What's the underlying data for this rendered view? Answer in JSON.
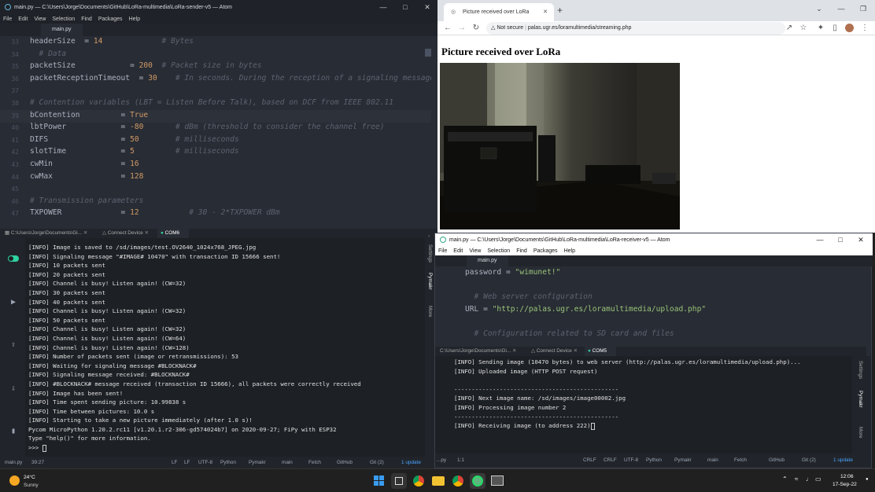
{
  "sender": {
    "title": "main.py — C:\\Users\\Jorge\\Documents\\GitHub\\LoRa-multimedia\\LoRa-sender-v5 — Atom",
    "menu": [
      "File",
      "Edit",
      "View",
      "Selection",
      "Find",
      "Packages",
      "Help"
    ],
    "tab": "main.py",
    "lines": [
      {
        "n": "33",
        "parts": [
          [
            "",
            "headerSize  = "
          ],
          [
            "kw",
            "14"
          ],
          [
            "",
            "             "
          ],
          [
            "cm",
            "# Bytes"
          ]
        ]
      },
      {
        "n": "34",
        "parts": [
          [
            "cm",
            "  # Data"
          ]
        ]
      },
      {
        "n": "35",
        "parts": [
          [
            "",
            "packetSize            = "
          ],
          [
            "kw",
            "200"
          ],
          [
            "",
            "  "
          ],
          [
            "cm",
            "# Packet size in bytes"
          ]
        ]
      },
      {
        "n": "36",
        "parts": [
          [
            "",
            "packetReceptionTimeout  = "
          ],
          [
            "kw",
            "30"
          ],
          [
            "",
            "    "
          ],
          [
            "cm",
            "# In seconds. During the reception of a signaling message"
          ]
        ]
      },
      {
        "n": "37",
        "parts": [
          [
            "",
            ""
          ]
        ]
      },
      {
        "n": "38",
        "parts": [
          [
            "cm",
            "# Contention variables (LBT = Listen Before Talk), based on DCF from IEEE 802.11"
          ]
        ]
      },
      {
        "n": "39",
        "parts": [
          [
            "",
            "bContention         = "
          ],
          [
            "kw",
            "True"
          ]
        ]
      },
      {
        "n": "40",
        "parts": [
          [
            "",
            "lbtPower            = "
          ],
          [
            "kw",
            "-80"
          ],
          [
            "",
            "       "
          ],
          [
            "cm",
            "# dBm (threshold to consider the channel free)"
          ]
        ]
      },
      {
        "n": "41",
        "parts": [
          [
            "",
            "DIFS                = "
          ],
          [
            "kw",
            "50"
          ],
          [
            "",
            "        "
          ],
          [
            "cm",
            "# milliseconds"
          ]
        ]
      },
      {
        "n": "42",
        "parts": [
          [
            "",
            "slotTime            = "
          ],
          [
            "kw",
            "5"
          ],
          [
            "",
            "         "
          ],
          [
            "cm",
            "# milliseconds"
          ]
        ]
      },
      {
        "n": "43",
        "parts": [
          [
            "",
            "cwMin               = "
          ],
          [
            "kw",
            "16"
          ]
        ]
      },
      {
        "n": "44",
        "parts": [
          [
            "",
            "cwMax               = "
          ],
          [
            "kw",
            "128"
          ]
        ]
      },
      {
        "n": "45",
        "parts": [
          [
            "",
            ""
          ]
        ]
      },
      {
        "n": "46",
        "parts": [
          [
            "cm",
            "# Transmission parameters"
          ]
        ]
      },
      {
        "n": "47",
        "parts": [
          [
            "",
            "TXPOWER             = "
          ],
          [
            "kw",
            "12"
          ],
          [
            "",
            "           "
          ],
          [
            "cm",
            "# 30 - 2*TXPOWER dBm"
          ]
        ]
      }
    ],
    "panel_tabs": [
      "C:\\Users\\Jorge\\Documents\\Gi...",
      "Connect Device",
      "COM6"
    ],
    "console": [
      "[INFO] Image is saved to /sd/images/test.OV2640_1024x768_JPEG.jpg",
      "[INFO] Signaling message \"#IMAGE# 10470\" with transaction ID 15666 sent!",
      "[INFO] 10 packets sent",
      "[INFO] 20 packets sent",
      "[INFO] Channel is busy! Listen again! (CW=32)",
      "[INFO] 30 packets sent",
      "[INFO] 40 packets sent",
      "[INFO] Channel is busy! Listen again! (CW=32)",
      "[INFO] 50 packets sent",
      "[INFO] Channel is busy! Listen again! (CW=32)",
      "[INFO] Channel is busy! Listen again! (CW=64)",
      "[INFO] Channel is busy! Listen again! (CW=128)",
      "[INFO] Number of packets sent (image or retransmissions): 53",
      "[INFO] Waiting for signaling message #BLOCKNACK#",
      "[INFO] Signaling message received: #BLOCKNACK#",
      "[INFO] #BLOCKNACK# message received (transaction ID 15666), all packets were correctly received",
      "[INFO] Image has been sent!",
      "[INFO] Time spent sending picture: 10.99838 s",
      "[INFO] Time between pictures: 10.0 s",
      "[INFO] Starting to take a new picture immediately (after 1.0 s)!",
      "Pycom MicroPython 1.20.2.rc11 [v1.20.1.r2-306-gd574024b7] on 2020-09-27; FiPy with ESP32",
      "Type \"help()\" for more information.",
      ">>> "
    ],
    "side_labels": [
      "Settings",
      "Pymakr",
      "More"
    ],
    "status_left": [
      "main.py",
      "39:27"
    ],
    "status_right": [
      "LF",
      "LF",
      "UTF-8",
      "Python",
      "Pymakr",
      "main",
      "Fetch",
      "GitHub",
      "Git (2)",
      "1 update"
    ]
  },
  "browser": {
    "tab_title": "Picture received over LoRa",
    "not_secure": "Not secure",
    "url": "palas.ugr.es/loramultimedia/streaming.php",
    "heading": "Picture received over LoRa"
  },
  "receiver": {
    "title": "main.py — C:\\Users\\Jorge\\Documents\\GitHub\\LoRa-multimedia\\LoRa-receiver-v5 — Atom",
    "menu": [
      "File",
      "Edit",
      "View",
      "Selection",
      "Find",
      "Packages",
      "Help"
    ],
    "tab": "main.py",
    "lines": [
      {
        "parts": [
          [
            "",
            "password = "
          ],
          [
            "st",
            "\"wimunet!\""
          ]
        ]
      },
      {
        "parts": [
          [
            "",
            ""
          ]
        ]
      },
      {
        "parts": [
          [
            "cm",
            "  # Web server configuration"
          ]
        ]
      },
      {
        "parts": [
          [
            "",
            "URL = "
          ],
          [
            "st",
            "\"http://palas.ugr.es/loramultimedia/upload.php\""
          ]
        ]
      },
      {
        "parts": [
          [
            "",
            ""
          ]
        ]
      },
      {
        "parts": [
          [
            "cm",
            "  # Configuration related to SD card and files"
          ]
        ]
      }
    ],
    "panel_tabs": [
      "C:\\Users\\Jorge\\Documents\\Gi...",
      "Connect Device",
      "COM5"
    ],
    "console": [
      "[INFO] Sending image (10470 bytes) to web server (http://palas.ugr.es/loramultimedia/upload.php)...",
      "[INFO] Uploaded image (HTTP POST request)",
      "",
      "-----------------------------------------------",
      "[INFO] Next image name: /sd/images/image00002.jpg",
      "[INFO] Processing image number 2",
      "-----------------------------------------------",
      "[INFO] Receiving image (to address 222)"
    ],
    "side_labels": [
      "Settings",
      "Pymakr",
      "More"
    ],
    "status_left": [
      "...py",
      "1:1"
    ],
    "status_right": [
      "CRLF",
      "CRLF",
      "UTF-8",
      "Python",
      "Pymakr",
      "main",
      "Fetch",
      "GitHub",
      "Git (2)",
      "1 update"
    ]
  },
  "taskbar": {
    "temp": "24°C",
    "weather": "Sunny",
    "time": "12:06",
    "date": "17-Sep-22"
  }
}
